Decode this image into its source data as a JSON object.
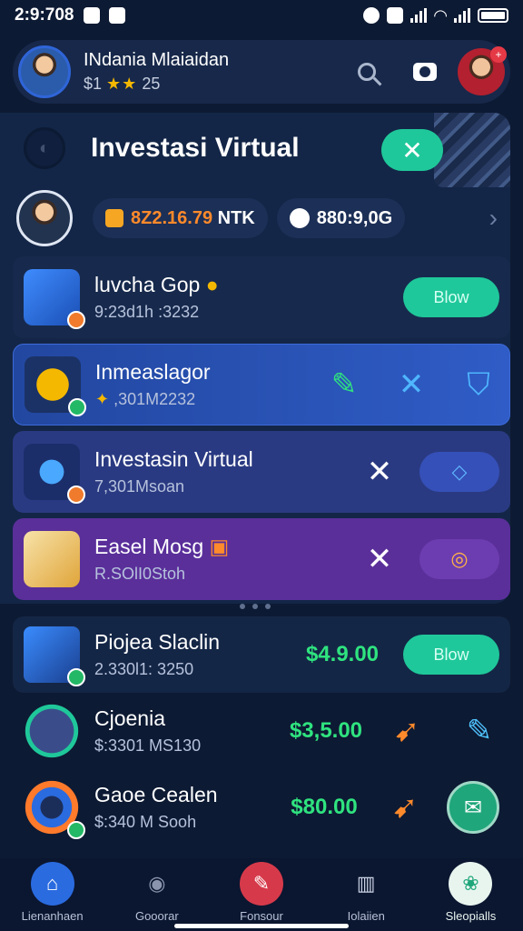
{
  "status": {
    "time": "2:9:708"
  },
  "header": {
    "name": "INdania Mlaiaidan",
    "rating_prefix": "$1",
    "stars": "★★",
    "rating_value": "25"
  },
  "panel": {
    "title": "Investasi Virtual",
    "close_label": "✕"
  },
  "wallet": {
    "balance": "8Z2.16.79",
    "balance_unit": "NTK",
    "chats": "880:9,0G"
  },
  "cards": [
    {
      "title": "luvcha Gop",
      "subtitle": "9:23d1h :3232",
      "action": "Blow"
    },
    {
      "title": "Inmeaslagor",
      "subtitle": ",301M2232"
    },
    {
      "title": "Investasin Virtual",
      "subtitle": "7,301Msoan"
    },
    {
      "title": "Easel Mosg",
      "subtitle": "R.SOlI0Stoh"
    }
  ],
  "list": [
    {
      "title": "Piojea Slaclin",
      "subtitle": "2.330l1: 3250",
      "price": "$4.9.00",
      "action": "Blow"
    },
    {
      "title": "Cjoenia",
      "subtitle": "$:3301 MS130",
      "price": "$3,5.00"
    },
    {
      "title": "Gaoe Cealen",
      "subtitle": "$:340 M Sooh",
      "price": "$80.00"
    }
  ],
  "nav": [
    {
      "label": "Lienanhaen"
    },
    {
      "label": "Gooorar"
    },
    {
      "label": "Fonsour"
    },
    {
      "label": "Iolaiien"
    },
    {
      "label": "Sleopialls"
    }
  ],
  "colors": {
    "background": "#0d1a33",
    "accent_green": "#1fc89a",
    "price_green": "#2fe37f",
    "card_blue": "#2c55b8",
    "card_indigo": "#2a3a82",
    "card_purple": "#5a2f9a"
  }
}
